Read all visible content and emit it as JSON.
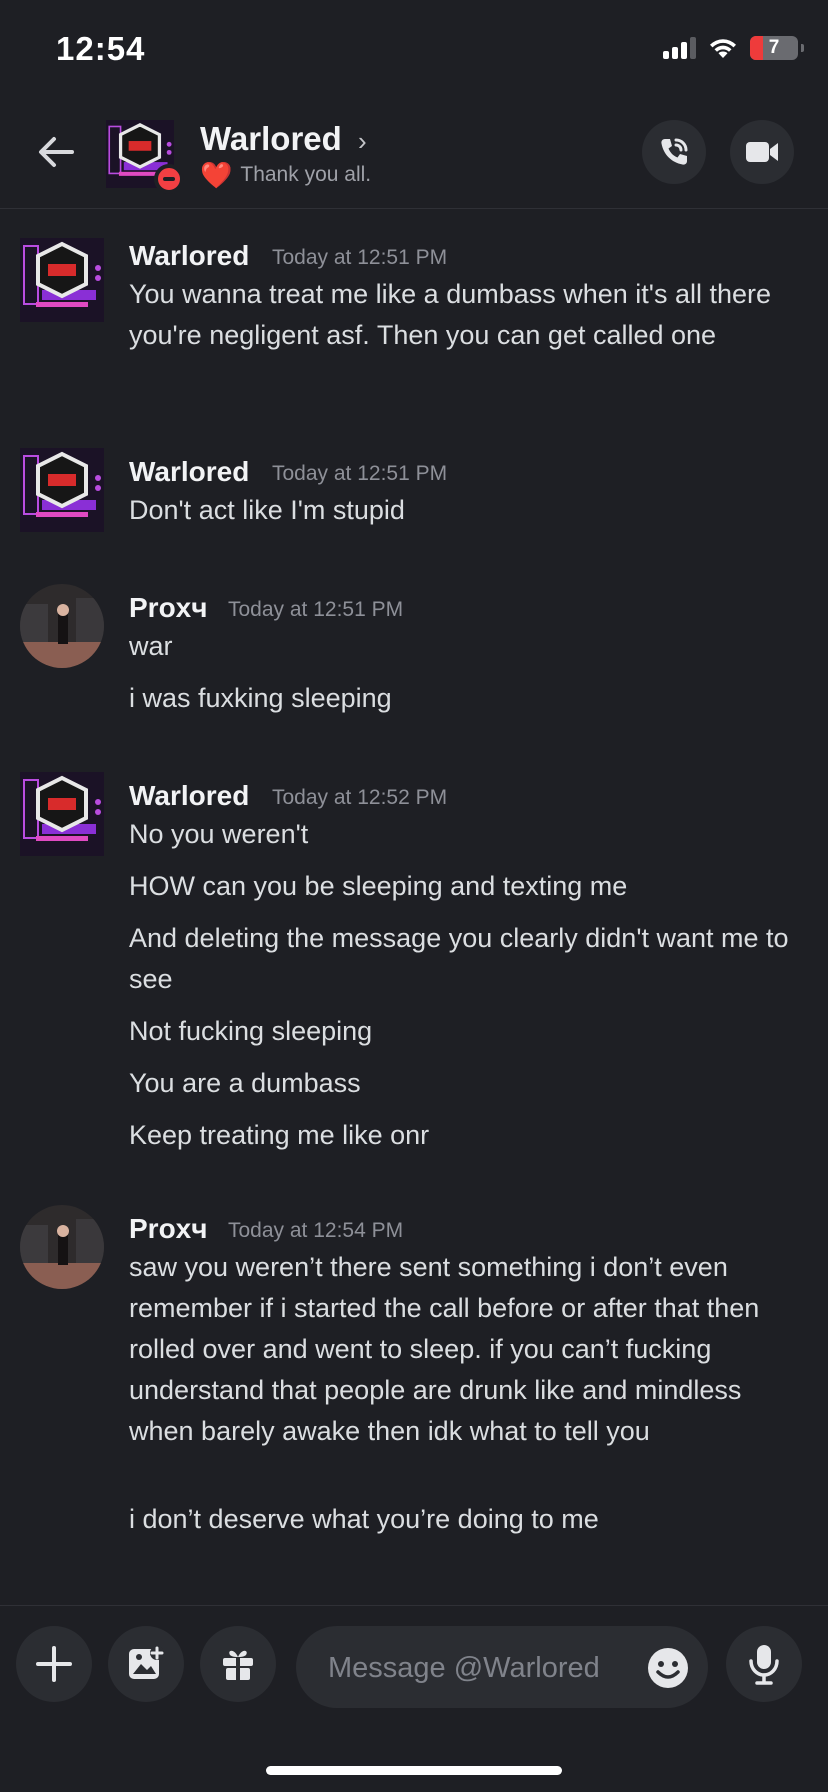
{
  "status_bar": {
    "time": "12:54",
    "battery_level": "7",
    "battery_fraction": 0.07,
    "icons": [
      "cellular-signal-icon",
      "wifi-icon",
      "battery-icon"
    ]
  },
  "header": {
    "name": "Warlored",
    "chevron": "›",
    "status_emoji": "❤️",
    "status_text": "Thank you all.",
    "presence": "do-not-disturb",
    "icons": [
      "back-arrow-icon",
      "voice-call-icon",
      "video-call-icon"
    ]
  },
  "messages": [
    {
      "author": "Warlored",
      "timestamp": "Today at 12:51 PM",
      "lines": [
        "You wanna treat me like a dumbass when it's all there you're negligent asf. Then you can get called one"
      ]
    },
    {
      "author": "Warlored",
      "timestamp": "Today at 12:51 PM",
      "lines": [
        "Don't act like I'm stupid"
      ]
    },
    {
      "author": "Proxч",
      "timestamp": "Today at 12:51 PM",
      "lines": [
        "war",
        "i was fuxking sleeping"
      ]
    },
    {
      "author": "Warlored",
      "timestamp": "Today at 12:52 PM",
      "lines": [
        "No you weren't",
        "HOW can you be sleeping and texting me",
        "And deleting the message you clearly didn't want me to see",
        "Not fucking sleeping",
        "You are a dumbass",
        "Keep treating me like onr"
      ]
    },
    {
      "author": "Proxч",
      "timestamp": "Today at 12:54 PM",
      "lines": [
        "saw you weren’t there sent something i don’t even remember if i started the call before or after that then rolled over and went to sleep. if you can’t fucking understand that people are drunk like and mindless when barely awake then idk what to tell you",
        "i don’t deserve what you’re doing to me"
      ]
    }
  ],
  "composer": {
    "placeholder": "Message @Warlored",
    "value": "",
    "icons": [
      "plus-icon",
      "image-icon",
      "gift-icon",
      "emoji-icon",
      "microphone-icon"
    ]
  },
  "colors": {
    "background": "#1e1f24",
    "button_bg": "#2b2d32",
    "dnd_red": "#f23f43",
    "heart_red": "#e5252a"
  }
}
